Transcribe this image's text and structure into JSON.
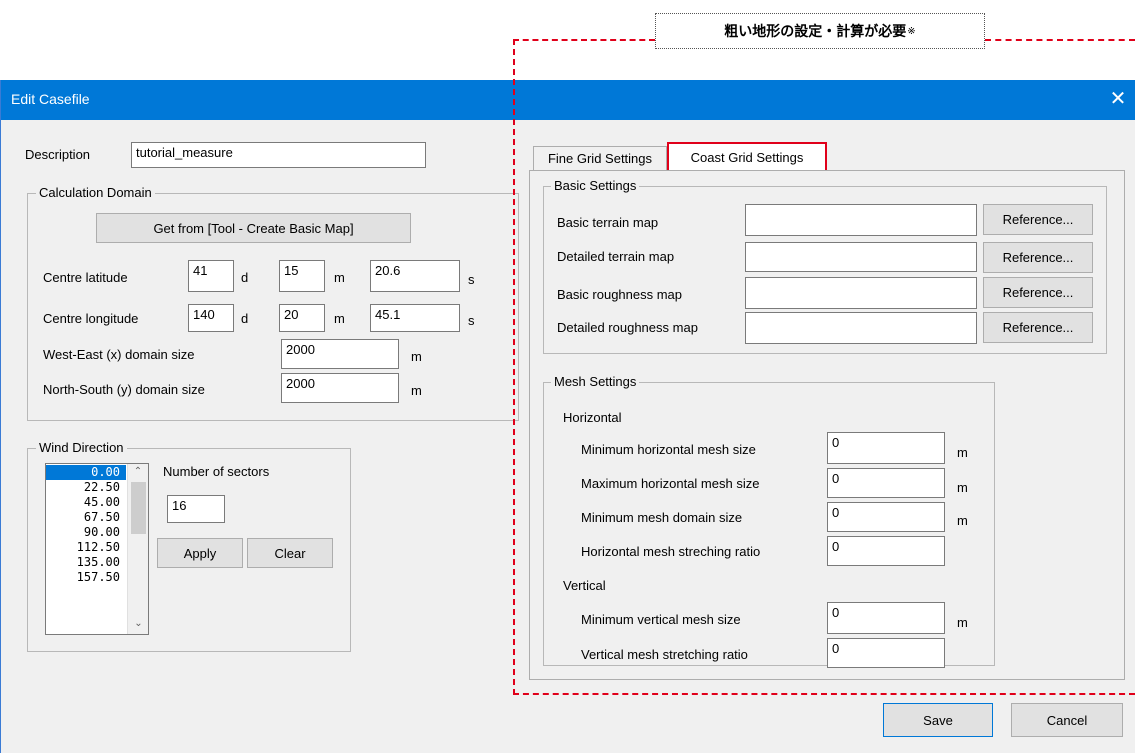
{
  "annotation": {
    "label": "粗い地形の設定・計算が必要",
    "mark": "※",
    "color": "#e0001a"
  },
  "window": {
    "title": "Edit Casefile",
    "close_glyph": "✕",
    "titlebar_color": "#0078d7"
  },
  "description": {
    "label": "Description",
    "value": "tutorial_measure"
  },
  "calc_domain": {
    "title": "Calculation Domain",
    "get_from_button": "Get from [Tool - Create Basic Map]",
    "centre_latitude": {
      "label": "Centre latitude",
      "deg": "41",
      "min": "15",
      "sec": "20.6"
    },
    "centre_longitude": {
      "label": "Centre longitude",
      "deg": "140",
      "min": "20",
      "sec": "45.1"
    },
    "unit_d": "d",
    "unit_m": "m",
    "unit_s": "s",
    "we_size": {
      "label": "West-East (x) domain size",
      "value": "2000",
      "unit": "m"
    },
    "ns_size": {
      "label": "North-South (y) domain size",
      "value": "2000",
      "unit": "m"
    }
  },
  "wind_direction": {
    "title": "Wind Direction",
    "items": [
      "0.00",
      "22.50",
      "45.00",
      "67.50",
      "90.00",
      "112.50",
      "135.00",
      "157.50"
    ],
    "selected_index": 0,
    "sectors_label": "Number of sectors",
    "sectors_value": "16",
    "apply_button": "Apply",
    "clear_button": "Clear"
  },
  "tabs": [
    {
      "label": "Fine Grid Settings",
      "active": false
    },
    {
      "label": "Coast Grid Settings",
      "active": true
    }
  ],
  "basic_settings": {
    "title": "Basic Settings",
    "rows": [
      {
        "label": "Basic terrain map",
        "value": "",
        "button": "Reference..."
      },
      {
        "label": "Detailed terrain map",
        "value": "",
        "button": "Reference..."
      },
      {
        "label": "Basic roughness map",
        "value": "",
        "button": "Reference..."
      },
      {
        "label": "Detailed roughness map",
        "value": "",
        "button": "Reference..."
      }
    ]
  },
  "mesh_settings": {
    "title": "Mesh Settings",
    "horizontal_title": "Horizontal",
    "vertical_title": "Vertical",
    "min_h_mesh": {
      "label": "Minimum horizontal mesh size",
      "value": "0",
      "unit": "m"
    },
    "max_h_mesh": {
      "label": "Maximum horizontal mesh size",
      "value": "0",
      "unit": "m"
    },
    "min_mesh_domain": {
      "label": "Minimum mesh domain size",
      "value": "0",
      "unit": "m"
    },
    "h_stretch": {
      "label": "Horizontal mesh streching ratio",
      "value": "0"
    },
    "min_v_mesh": {
      "label": "Minimum vertical mesh size",
      "value": "0",
      "unit": "m"
    },
    "v_stretch": {
      "label": "Vertical mesh stretching ratio",
      "value": "0"
    }
  },
  "footer": {
    "save_button": "Save",
    "cancel_button": "Cancel"
  }
}
